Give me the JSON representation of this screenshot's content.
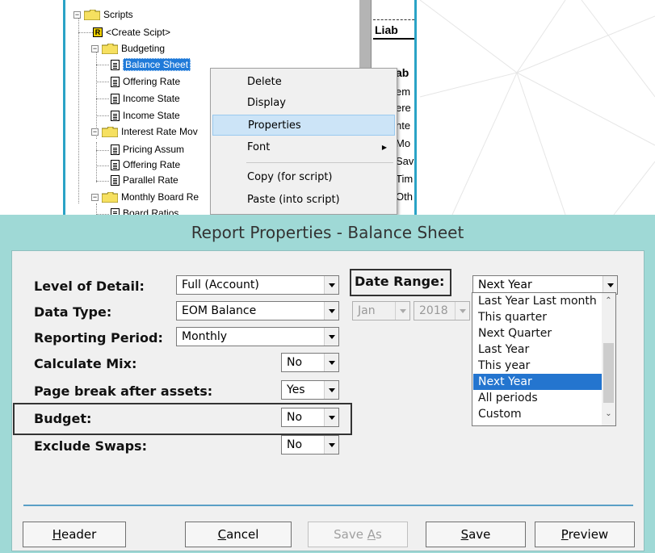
{
  "tree": {
    "items": [
      {
        "label": "Scripts",
        "type": "folder"
      },
      {
        "label": "<Create Scipt>",
        "type": "create"
      },
      {
        "label": "Budgeting",
        "type": "folder"
      },
      {
        "label": "Balance Sheet",
        "type": "doc",
        "selected": true
      },
      {
        "label": "Offering Rate",
        "type": "doc"
      },
      {
        "label": "Income State",
        "type": "doc"
      },
      {
        "label": "Income State",
        "type": "doc"
      },
      {
        "label": "Interest Rate Mov",
        "type": "folder"
      },
      {
        "label": "Pricing Assum",
        "type": "doc"
      },
      {
        "label": "Offering Rate",
        "type": "doc"
      },
      {
        "label": "Parallel Rate",
        "type": "doc"
      },
      {
        "label": "Monthly Board Re",
        "type": "folder"
      },
      {
        "label": "Board Ratios",
        "type": "doc"
      }
    ],
    "right_heading": "Liab",
    "right_heading2": "ab",
    "right_fragments": [
      "em",
      "ere",
      "nte",
      "Mo",
      "Sav",
      "Tim",
      "Oth"
    ]
  },
  "context_menu": {
    "items": [
      {
        "label": "Delete"
      },
      {
        "label": "Display"
      },
      {
        "label": "Properties",
        "highlighted": true
      },
      {
        "label": "Font",
        "submenu": true
      },
      {
        "label": "Copy (for script)"
      },
      {
        "label": "Paste (into script)"
      }
    ]
  },
  "dialog": {
    "title": "Report Properties - Balance Sheet",
    "fields": {
      "level_of_detail": {
        "label": "Level of Detail:",
        "value": "Full (Account)"
      },
      "data_type": {
        "label": "Data Type:",
        "value": "EOM Balance"
      },
      "reporting_period": {
        "label": "Reporting Period:",
        "value": "Monthly"
      },
      "calculate_mix": {
        "label": "Calculate Mix:",
        "value": "No"
      },
      "page_break": {
        "label": "Page break after assets:",
        "value": "Yes"
      },
      "budget": {
        "label": "Budget:",
        "value": "No"
      },
      "exclude_swaps": {
        "label": "Exclude Swaps:",
        "value": "No"
      }
    },
    "date_range": {
      "label": "Date Range:",
      "value": "Next Year",
      "month": "Jan",
      "year": "2018",
      "options": [
        "Last Year Last month",
        "This quarter",
        "Next Quarter",
        "Last Year",
        "This year",
        "Next Year",
        "All periods",
        "Custom"
      ],
      "selected_option": "Next Year"
    },
    "buttons": {
      "header": {
        "pre": "",
        "mn": "H",
        "post": "eader"
      },
      "cancel": {
        "pre": "",
        "mn": "C",
        "post": "ancel"
      },
      "save_as": {
        "pre": "Save ",
        "mn": "A",
        "post": "s"
      },
      "save": {
        "pre": "",
        "mn": "S",
        "post": "ave"
      },
      "preview": {
        "pre": "",
        "mn": "P",
        "post": "review"
      }
    }
  }
}
